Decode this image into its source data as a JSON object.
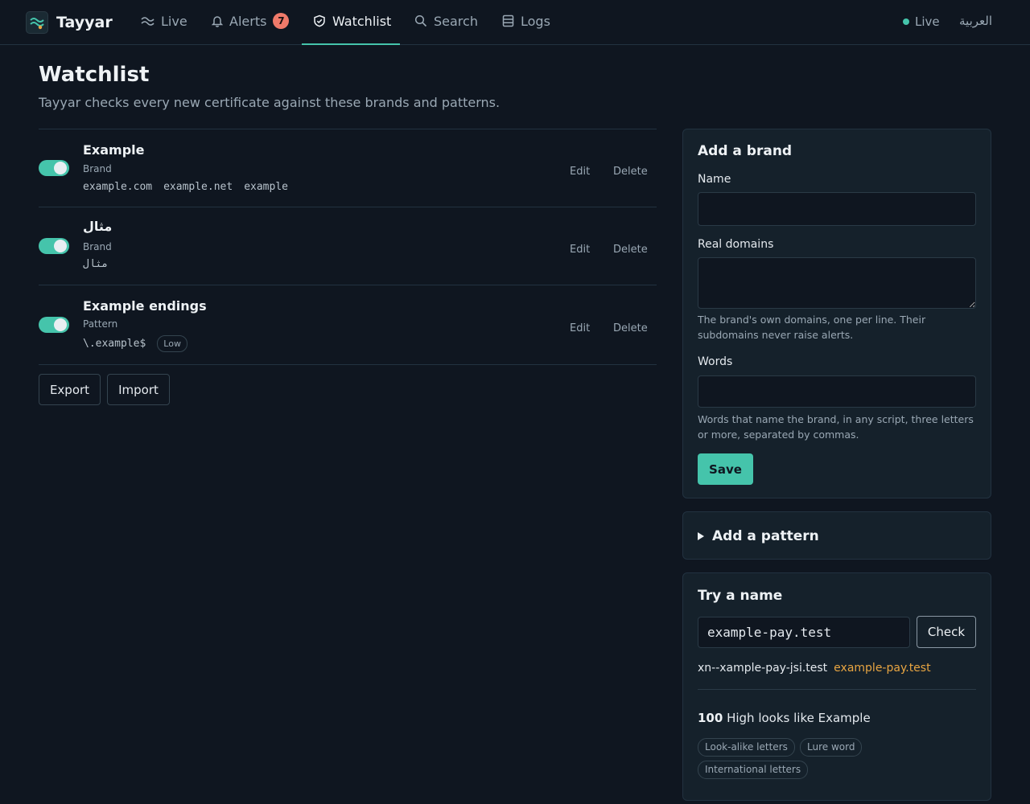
{
  "app": {
    "name": "Tayyar"
  },
  "nav": {
    "live": "Live",
    "alerts": "Alerts",
    "alerts_count": "7",
    "watchlist": "Watchlist",
    "search": "Search",
    "logs": "Logs",
    "status": "Live",
    "language": "العربية"
  },
  "page": {
    "title": "Watchlist",
    "subtitle": "Tayyar checks every new certificate against these brands and patterns."
  },
  "watchlist": {
    "items": [
      {
        "name": "Example",
        "type": "Brand",
        "enabled": true,
        "terms": [
          "example.com",
          "example.net",
          "example"
        ]
      },
      {
        "name": "مثال",
        "type": "Brand",
        "enabled": true,
        "terms": [
          "مثال"
        ]
      },
      {
        "name": "Example endings",
        "type": "Pattern",
        "enabled": true,
        "terms": [
          "\\.example$"
        ],
        "severity": "Low"
      }
    ],
    "edit_label": "Edit",
    "delete_label": "Delete",
    "export_label": "Export",
    "import_label": "Import"
  },
  "add_brand": {
    "title": "Add a brand",
    "name_label": "Name",
    "name_value": "",
    "domains_label": "Real domains",
    "domains_value": "",
    "domains_help": "The brand's own domains, one per line. Their subdomains never raise alerts.",
    "words_label": "Words",
    "words_value": "",
    "words_help": "Words that name the brand, in any script, three letters or more, separated by commas.",
    "save_label": "Save"
  },
  "add_pattern": {
    "title": "Add a pattern",
    "expanded": false
  },
  "try_name": {
    "title": "Try a name",
    "input_value": "example-pay.test",
    "check_label": "Check",
    "punycode": "xn--xample-pay-jsi.test",
    "unicode": "example-pay.test",
    "score": "100",
    "verdict": "High looks like Example",
    "reasons": [
      "Look-alike letters",
      "Lure word",
      "International letters"
    ]
  },
  "colors": {
    "accent": "#45c4ab",
    "badge": "#ef7a6a",
    "highlight": "#e8a542",
    "background": "#0f1620",
    "card": "#15212b"
  },
  "icons": {
    "logo": "wave-logo-icon",
    "live": "wave-icon",
    "alerts": "bell-icon",
    "watchlist": "shield-icon",
    "search": "search-icon",
    "logs": "database-icon",
    "disclosure": "triangle-right-icon"
  }
}
